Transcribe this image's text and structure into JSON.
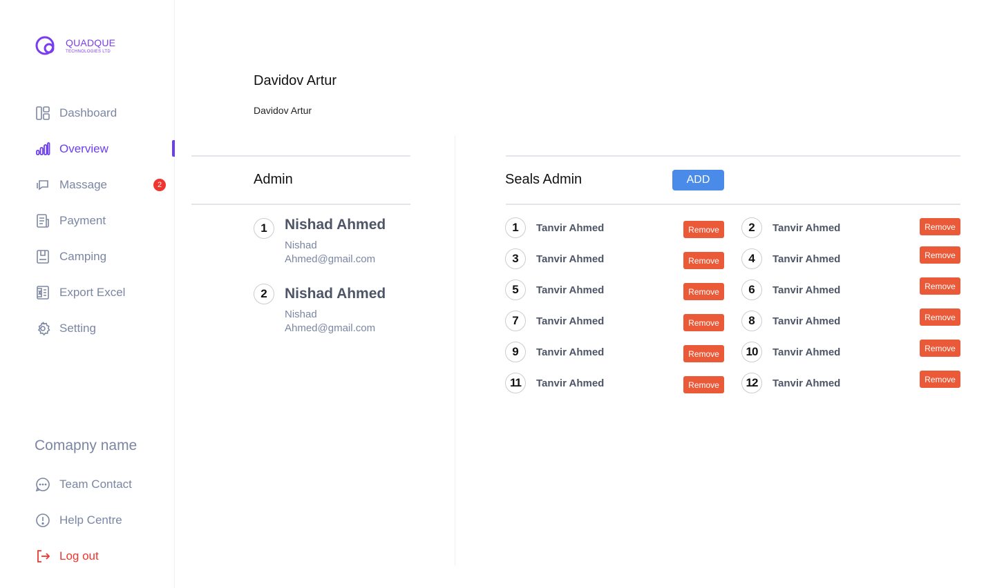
{
  "brand": {
    "name": "QUADQUE",
    "subtitle": "TECHNOLOGIES LTD",
    "color": "#7a3cf0"
  },
  "sidebar": {
    "items": [
      {
        "label": "Dashboard",
        "icon": "dashboard-icon"
      },
      {
        "label": "Overview",
        "icon": "bar-chart-icon",
        "active": true
      },
      {
        "label": "Massage",
        "icon": "message-icon",
        "badge": "2"
      },
      {
        "label": "Payment",
        "icon": "document-icon"
      },
      {
        "label": "Camping",
        "icon": "clipboard-icon"
      },
      {
        "label": "Export Excel",
        "icon": "excel-icon"
      },
      {
        "label": "Setting",
        "icon": "gear-icon"
      }
    ],
    "company_label": "Comapny name",
    "footer_items": [
      {
        "label": "Team Contact",
        "icon": "chat-bubble-icon"
      },
      {
        "label": "Help Centre",
        "icon": "info-icon"
      },
      {
        "label": "Log out",
        "icon": "logout-icon"
      }
    ]
  },
  "header": {
    "title": "Davidov Artur",
    "subtitle": "Davidov Artur"
  },
  "admin": {
    "title": "Admin",
    "items": [
      {
        "num": "1",
        "name": "Nishad Ahmed",
        "email": "Nishad Ahmed@gmail.com"
      },
      {
        "num": "2",
        "name": "Nishad Ahmed",
        "email": "Nishad Ahmed@gmail.com"
      }
    ]
  },
  "seals": {
    "title": "Seals Admin",
    "add_label": "ADD",
    "remove_label": "Remove",
    "items": [
      {
        "num": "1",
        "name": "Tanvir Ahmed"
      },
      {
        "num": "2",
        "name": "Tanvir Ahmed"
      },
      {
        "num": "3",
        "name": "Tanvir Ahmed"
      },
      {
        "num": "4",
        "name": "Tanvir Ahmed"
      },
      {
        "num": "5",
        "name": "Tanvir Ahmed"
      },
      {
        "num": "6",
        "name": "Tanvir Ahmed"
      },
      {
        "num": "7",
        "name": "Tanvir Ahmed"
      },
      {
        "num": "8",
        "name": "Tanvir Ahmed"
      },
      {
        "num": "9",
        "name": "Tanvir Ahmed"
      },
      {
        "num": "10",
        "name": "Tanvir Ahmed"
      },
      {
        "num": "11",
        "name": "Tanvir Ahmed"
      },
      {
        "num": "12",
        "name": "Tanvir Ahmed"
      }
    ]
  },
  "colors": {
    "accent": "#6c3ef2",
    "muted_text": "#7b86a3",
    "badge": "#f0342e",
    "add_button": "#4a8ae8",
    "remove_button": "#ea5a38",
    "logout": "#f0342e"
  }
}
